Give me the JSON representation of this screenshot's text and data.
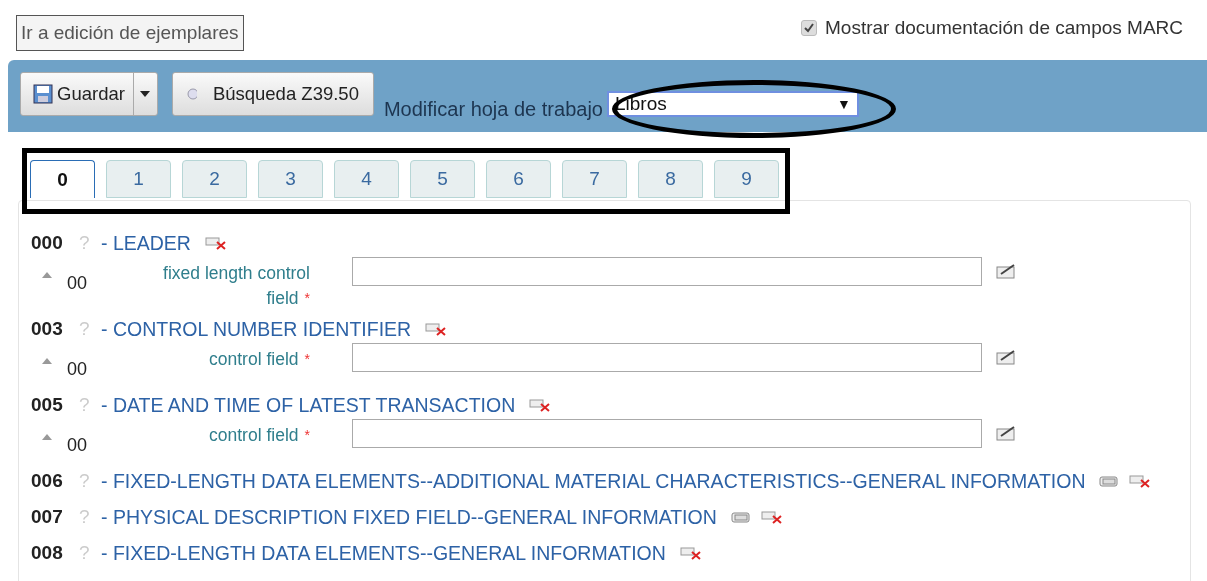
{
  "top_link": "Ir a edición de ejemplares",
  "doc_toggle": {
    "label": "Mostrar documentación de campos MARC",
    "checked": true
  },
  "toolbar": {
    "save": "Guardar",
    "z3950": "Búsqueda Z39.50",
    "sheet_label": "Modificar hoja de trabajo",
    "sheet_value": "Libros",
    "dropdown_arrow": "▼"
  },
  "tabs": [
    {
      "label": "0",
      "selected": true
    },
    {
      "label": "1",
      "selected": false
    },
    {
      "label": "2",
      "selected": false
    },
    {
      "label": "3",
      "selected": false
    },
    {
      "label": "4",
      "selected": false
    },
    {
      "label": "5",
      "selected": false
    },
    {
      "label": "6",
      "selected": false
    },
    {
      "label": "7",
      "selected": false
    },
    {
      "label": "8",
      "selected": false
    },
    {
      "label": "9",
      "selected": false
    }
  ],
  "fields": [
    {
      "tag": "000",
      "help": "?",
      "title": "- LEADER",
      "repeatable": false,
      "subfields": [
        {
          "code": "00",
          "label": "fixed length control field",
          "required": "*"
        }
      ]
    },
    {
      "tag": "003",
      "help": "?",
      "title": "- CONTROL NUMBER IDENTIFIER",
      "repeatable": false,
      "subfields": [
        {
          "code": "00",
          "label": "control field",
          "required": "*"
        }
      ]
    },
    {
      "tag": "005",
      "help": "?",
      "title": "- DATE AND TIME OF LATEST TRANSACTION",
      "repeatable": false,
      "subfields": [
        {
          "code": "00",
          "label": "control field",
          "required": "*"
        }
      ]
    },
    {
      "tag": "006",
      "help": "?",
      "title": "- FIXED-LENGTH DATA ELEMENTS--ADDITIONAL MATERIAL CHARACTERISTICS--GENERAL INFORMATION",
      "repeatable": true
    },
    {
      "tag": "007",
      "help": "?",
      "title": "- PHYSICAL DESCRIPTION FIXED FIELD--GENERAL INFORMATION",
      "repeatable": true
    },
    {
      "tag": "008",
      "help": "?",
      "title": "- FIXED-LENGTH DATA ELEMENTS--GENERAL INFORMATION",
      "repeatable": false
    }
  ]
}
